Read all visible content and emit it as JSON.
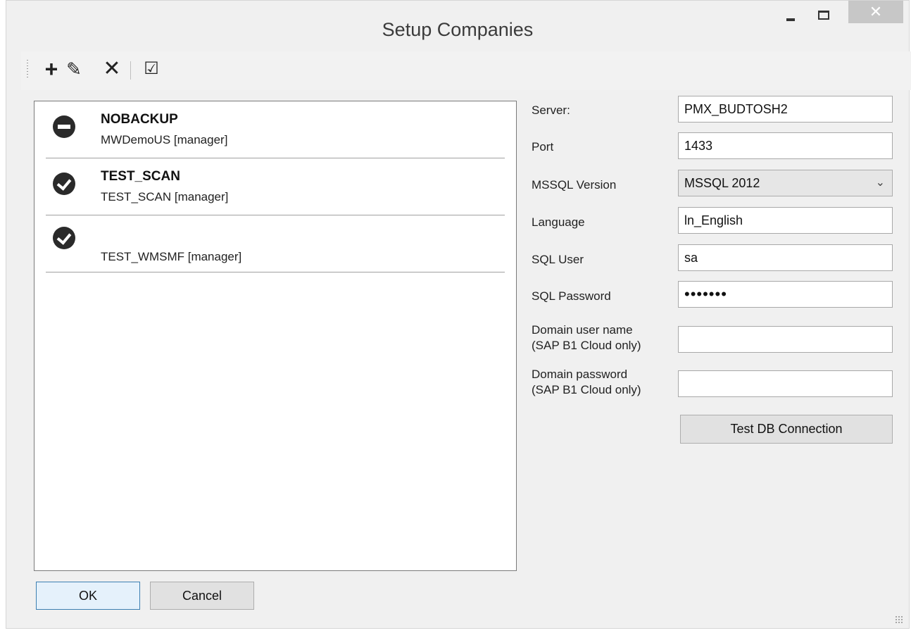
{
  "window": {
    "title": "Setup Companies",
    "close_glyph": "✕"
  },
  "toolbar": {
    "add_icon": "+",
    "edit_icon": "✎",
    "delete_icon": "✕",
    "select_icon": "☑"
  },
  "companies": [
    {
      "name": "NOBACKUP",
      "detail": "MWDemoUS [manager]",
      "status_icon": "minus-circle-icon"
    },
    {
      "name": "TEST_SCAN",
      "detail": "TEST_SCAN [manager]",
      "status_icon": "check-circle-icon"
    },
    {
      "name": "",
      "detail": "TEST_WMSMF [manager]",
      "status_icon": "check-circle-icon"
    }
  ],
  "form": {
    "server_label": "Server:",
    "server_value": "PMX_BUDTOSH2",
    "port_label": "Port",
    "port_value": "1433",
    "mssql_label": "MSSQL Version",
    "mssql_value": "MSSQL 2012",
    "language_label": "Language",
    "language_value": "ln_English",
    "sql_user_label": "SQL User",
    "sql_user_value": "sa",
    "sql_password_label": "SQL Password",
    "sql_password_value": "•••••••",
    "domain_user_label_line1": "Domain user name",
    "domain_user_label_line2": "(SAP B1 Cloud only)",
    "domain_user_value": "",
    "domain_password_label_line1": "Domain password",
    "domain_password_label_line2": "(SAP B1 Cloud only)",
    "domain_password_value": "",
    "test_button": "Test DB Connection"
  },
  "footer": {
    "ok_label": "OK",
    "cancel_label": "Cancel"
  },
  "colors": {
    "window_bg": "#f0f0f0",
    "close_button": "#c7c7c7",
    "ok_border": "#3c7fb1"
  }
}
